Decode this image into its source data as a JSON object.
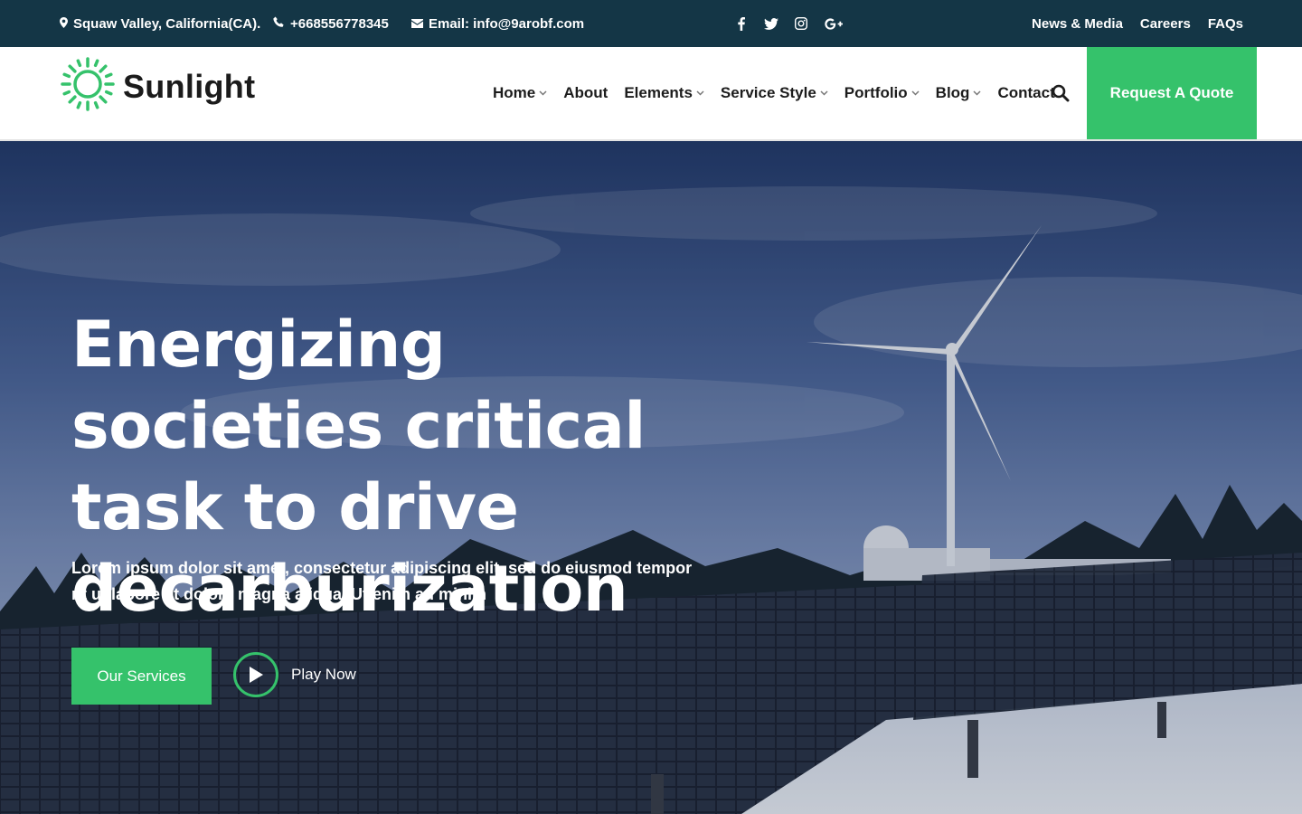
{
  "colors": {
    "accent": "#35c26b",
    "topbar": "#143646",
    "text_dark": "#1c1c1c"
  },
  "topbar": {
    "location": "Squaw Valley, California(CA).",
    "phone": "+668556778345",
    "email": "Email: info@9arobf.com",
    "social_icons": [
      "facebook-icon",
      "twitter-icon",
      "instagram-icon",
      "google-plus-icon"
    ],
    "links": [
      "News & Media",
      "Careers",
      "FAQs"
    ]
  },
  "header": {
    "logo_text": "Sunlight",
    "nav": [
      {
        "label": "Home",
        "dropdown": true
      },
      {
        "label": "About",
        "dropdown": false
      },
      {
        "label": "Elements",
        "dropdown": true
      },
      {
        "label": "Service Style",
        "dropdown": true
      },
      {
        "label": "Portfolio",
        "dropdown": true
      },
      {
        "label": "Blog",
        "dropdown": true
      },
      {
        "label": "Contact",
        "dropdown": false
      }
    ],
    "quote_button": "Request A Quote"
  },
  "hero": {
    "title": "Energizing societies critical task to drive decarburization",
    "text": "Lorem ipsum dolor sit amet, consectetur adipiscing elit, sed do eiusmod tempor nt ut labore et dolore magna aliqua. Ut enim ad minim",
    "services_button": "Our Services",
    "play_label": "Play Now"
  }
}
